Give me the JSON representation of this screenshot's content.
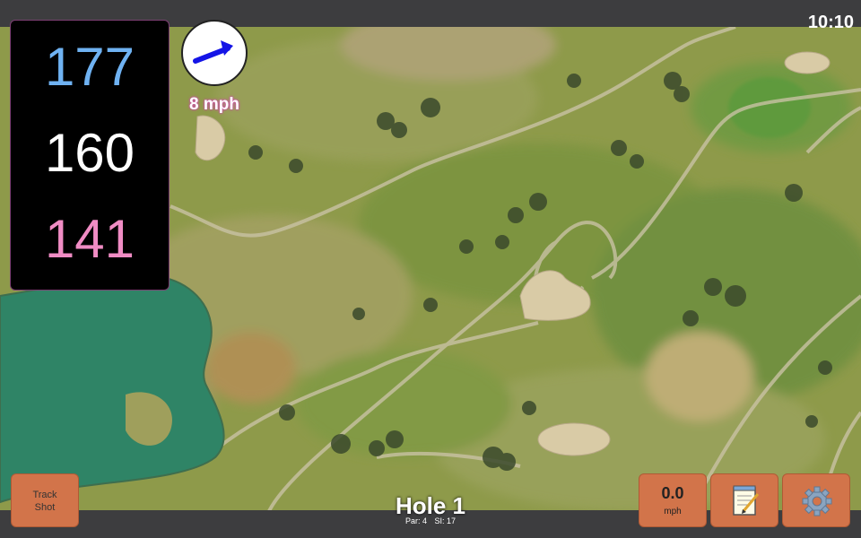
{
  "clock": "10:10",
  "yardage": {
    "back": "177",
    "middle": "160",
    "front": "141"
  },
  "wind": {
    "speed": "8 mph",
    "icon": "arrow-right-icon"
  },
  "buttons": {
    "track_shot_line1": "Track",
    "track_shot_line2": "Shot",
    "speed_value": "0.0",
    "speed_unit": "mph",
    "notes_icon": "notepad-icon",
    "settings_icon": "gear-icon"
  },
  "hole": {
    "title": "Hole 1",
    "par": "Par: 4",
    "si": "SI: 17"
  },
  "colors": {
    "back_yardage": "#6fb2f2",
    "middle_yardage": "#ffffff",
    "front_yardage": "#f08cc4",
    "button": "#d2744a",
    "water": "#2f8466"
  }
}
